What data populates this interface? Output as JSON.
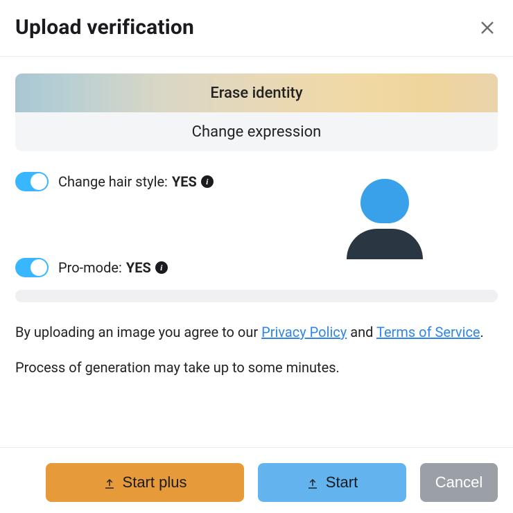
{
  "header": {
    "title": "Upload verification"
  },
  "segmented": {
    "top_label": "Erase identity",
    "bottom_label": "Change expression"
  },
  "toggles": {
    "hair": {
      "label_prefix": "Change hair style: ",
      "value": "YES",
      "on": true
    },
    "pro": {
      "label_prefix": "Pro-mode: ",
      "value": "YES",
      "on": true
    }
  },
  "legal": {
    "prefix": "By uploading an image you agree to our ",
    "privacy": "Privacy Policy",
    "mid": " and ",
    "terms": "Terms of Service",
    "suffix": "."
  },
  "note": "Process of generation may take up to some minutes.",
  "footer": {
    "start_plus": "Start plus",
    "start": "Start",
    "cancel": "Cancel"
  }
}
